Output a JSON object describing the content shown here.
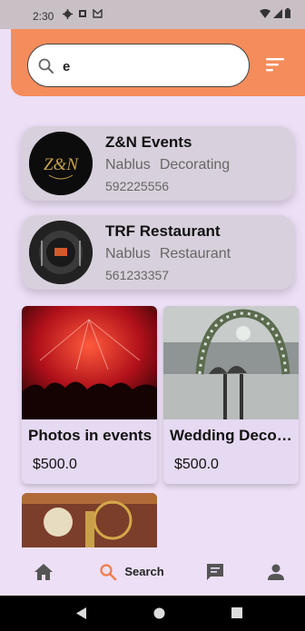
{
  "status_bar": {
    "time": "2:30",
    "icons": [
      "gear-icon",
      "square-icon",
      "mail-icon"
    ],
    "right_icons": [
      "wifi-icon",
      "signal-icon",
      "battery-icon"
    ]
  },
  "search": {
    "value": "e",
    "placeholder": ""
  },
  "vendors": [
    {
      "name": "Z&N Events",
      "city": "Nablus",
      "category": "Decorating",
      "phone": "592225556",
      "logo_text": "Z&N"
    },
    {
      "name": "TRF Restaurant",
      "city": "Nablus",
      "category": "Restaurant",
      "phone": "561233357",
      "logo_text": ""
    }
  ],
  "services": [
    {
      "title": "Photos in events",
      "price": "$500.0"
    },
    {
      "title": "Wedding Decoration",
      "price": "$500.0"
    }
  ],
  "bottom_nav": {
    "items": [
      "home-icon",
      "search-icon",
      "chat-icon",
      "person-icon"
    ],
    "active_label": "Search"
  },
  "colors": {
    "accent": "#f58c5c",
    "background": "#ecdff6",
    "active_icon": "#f07a4c"
  }
}
